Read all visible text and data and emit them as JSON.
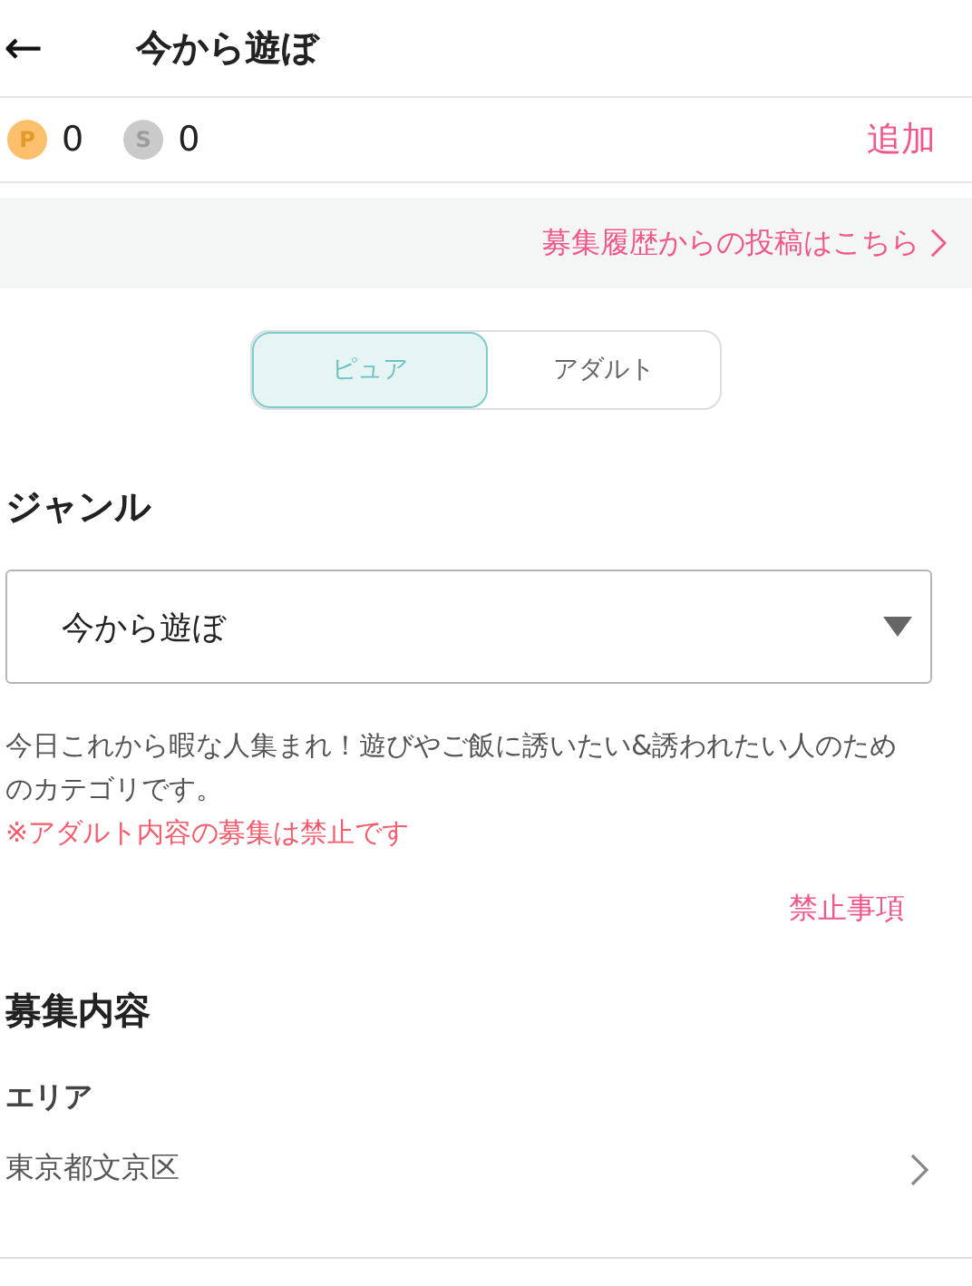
{
  "header": {
    "back": "←",
    "title": "今から遊ぼ"
  },
  "points": {
    "items": [
      {
        "kind": "p",
        "symbol": "P",
        "value": "0"
      },
      {
        "kind": "s",
        "symbol": "S",
        "value": "0"
      }
    ],
    "add": "追加"
  },
  "history_link": "募集履歴からの投稿はこちら",
  "tabs": [
    {
      "label": "ピュア",
      "selected": true
    },
    {
      "label": "アダルト",
      "selected": false
    }
  ],
  "genre": {
    "heading": "ジャンル",
    "value": "今から遊ぼ",
    "description": "今日これから暇な人集まれ！遊びやご飯に誘いたい&誘われたい人のためのカテゴリです。",
    "warning": "※アダルト内容の募集は禁止です",
    "rules_link": "禁止事項"
  },
  "content": {
    "heading": "募集内容",
    "area_label": "エリア",
    "area_value": "東京都文京区"
  }
}
